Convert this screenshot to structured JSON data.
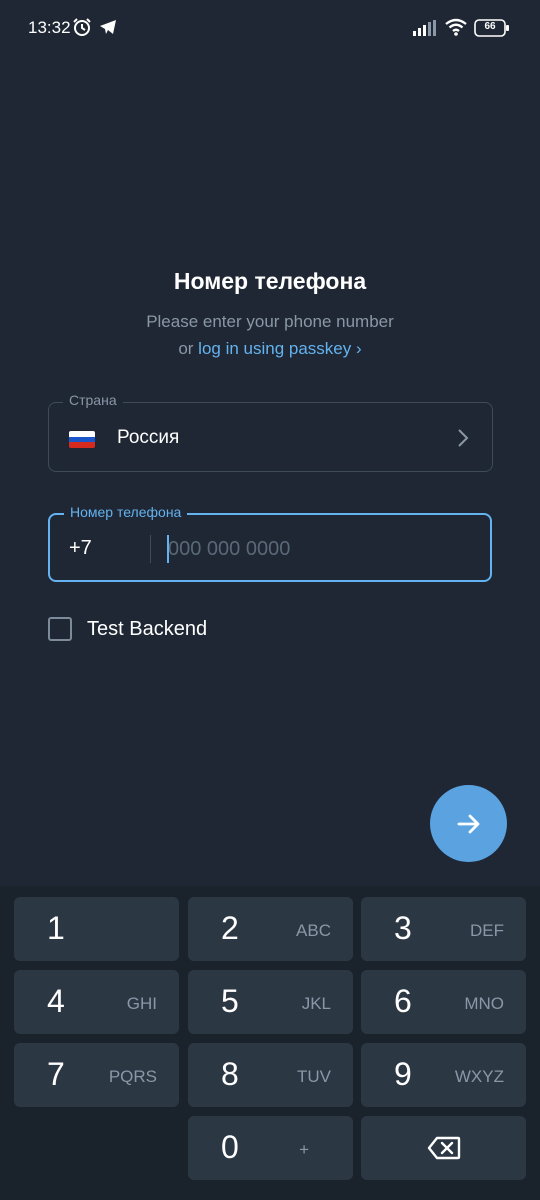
{
  "status_bar": {
    "time": "13:32",
    "battery_level": "66",
    "icons": [
      "alarm-icon",
      "telegram-icon",
      "signal-icon",
      "wifi-icon",
      "battery-icon"
    ]
  },
  "header": {
    "title": "Номер телефона",
    "subtitle": "Please enter your phone number",
    "or_text": "or",
    "passkey_link": "log in using passkey",
    "passkey_chevron": "›"
  },
  "country_field": {
    "label": "Страна",
    "value": "Россия",
    "flag": "russia-flag-icon"
  },
  "phone_field": {
    "label": "Номер телефона",
    "country_code": "+7",
    "value": "",
    "placeholder": "000 000 0000"
  },
  "test_backend": {
    "label": "Test Backend",
    "checked": false
  },
  "fab": {
    "icon": "arrow-right-icon"
  },
  "keypad": {
    "keys": [
      {
        "digit": "1",
        "letters": ""
      },
      {
        "digit": "2",
        "letters": "ABC"
      },
      {
        "digit": "3",
        "letters": "DEF"
      },
      {
        "digit": "4",
        "letters": "GHI"
      },
      {
        "digit": "5",
        "letters": "JKL"
      },
      {
        "digit": "6",
        "letters": "MNO"
      },
      {
        "digit": "7",
        "letters": "PQRS"
      },
      {
        "digit": "8",
        "letters": "TUV"
      },
      {
        "digit": "9",
        "letters": "WXYZ"
      },
      {
        "digit": "0",
        "letters": "+"
      }
    ],
    "backspace_icon": "backspace-icon"
  },
  "colors": {
    "background": "#1e2733",
    "accent": "#64b2ef",
    "fab": "#5aa2e0",
    "key": "#2c3744",
    "keypad_bg": "#1a222c",
    "muted_text": "#8a97a6"
  }
}
